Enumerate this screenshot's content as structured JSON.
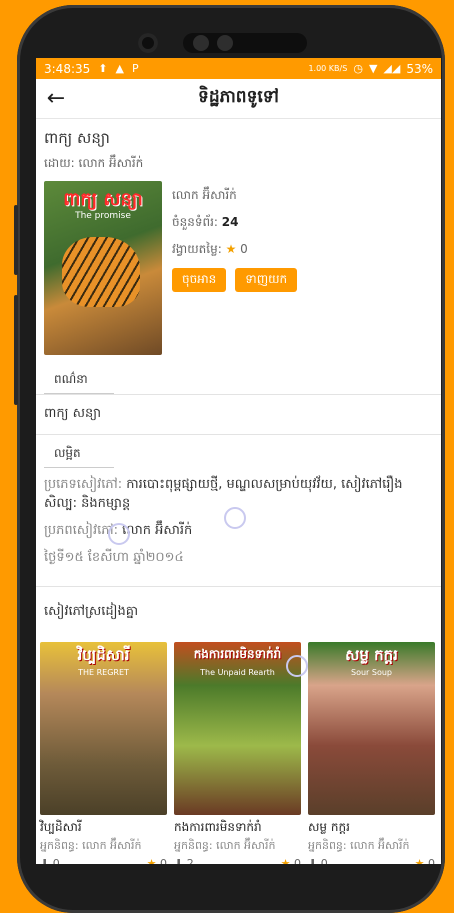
{
  "status": {
    "time": "3:48:35",
    "speed": "1.00 KB/S",
    "battery": "53%"
  },
  "appbar": {
    "title": "ទិដ្ឋភាពទូទៅ"
  },
  "book": {
    "title": "ពាក្យ សន្យា",
    "by": "ដោយ: លោក អ៊ឹសារីក់",
    "cover_title": "ពាក្យ សន្យា",
    "cover_subtitle": "The promise",
    "author": "លោក អ៊ឹសារីក់",
    "pages_label": "ចំនួនទំព័រ:",
    "pages": "24",
    "rating_label": "វង្វាយតម្លៃ:",
    "rating": "0",
    "read_label": "ចុចអាន",
    "download_label": "ទាញយក"
  },
  "tabs": {
    "description": "ពណ៌នា",
    "details": "លម្អិត"
  },
  "description_text": "ពាក្យ សន្យា",
  "details": {
    "category_label": "ប្រភេទសៀវភៅ:",
    "category_value": "ការបោះពុម្ពផ្សាយថ្មី, មណ្ឌលសម្រាប់យុវវ័យ, សៀវភៅរឿងសិល្ប: និងកម្សាន្ត",
    "source_label": "ប្រភពសៀវភៅ:",
    "source_value": "លោក អ៊ឹសារីក់",
    "date": "ថ្ងៃទី១៥ ខែសីហា ឆ្នាំ២០១៤"
  },
  "similar": {
    "title": "សៀវភៅស្រដៀងគ្នា",
    "items": [
      {
        "name": "វិប្បដិសារី",
        "author": "អ្នកនិពន្ធ: លោក អ៊ឹសារីក់",
        "banner": "វិប្បដិសារី",
        "banner_sub": "THE REGRET",
        "downloads": "0",
        "rating": "0"
      },
      {
        "name": "កងការពារមិនទាក់រាំ",
        "author": "អ្នកនិពន្ធ: លោក អ៊ឹសារីក់",
        "banner": "កងការពារមិនទាក់រាំ",
        "banner_sub": "The Unpaid Rearth",
        "downloads": "2",
        "rating": "0"
      },
      {
        "name": "សម្ល កក្តរ",
        "author": "អ្នកនិពន្ធ: លោក អ៊ឹសារីក់",
        "banner": "សម្ល កក្តរ",
        "banner_sub": "Sour Soup",
        "downloads": "0",
        "rating": "0"
      }
    ]
  }
}
